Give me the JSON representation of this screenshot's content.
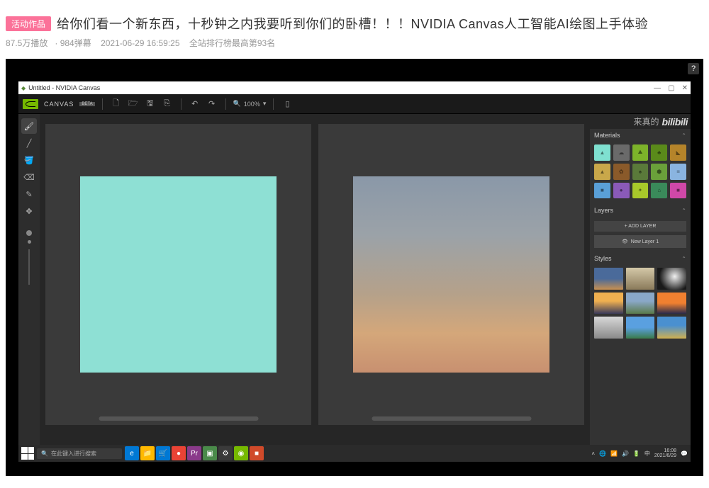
{
  "page": {
    "activity_tag": "活动作品",
    "video_title": "给你们看一个新东西，十秒钟之内我要听到你们的卧槽！！！NVIDIA Canvas人工智能AI绘图上手体验",
    "play_count": "87.5万播放",
    "danmu_count": "984弹幕",
    "publish_time": "2021-06-29 16:59:25",
    "rank_text": "全站排行榜最高第93名",
    "help_icon": "?"
  },
  "window": {
    "title": "Untitled - NVIDIA Canvas",
    "min": "—",
    "max": "▢",
    "close": "✕"
  },
  "app": {
    "brand": "CANVAS",
    "beta": "BETA",
    "zoom_label": "100%"
  },
  "watermark": {
    "text": "来真的",
    "logo": "bilibili"
  },
  "panels": {
    "materials_title": "Materials",
    "layers_title": "Layers",
    "add_layer": "+ ADD LAYER",
    "layer_name": "New Layer 1",
    "styles_title": "Styles"
  },
  "materials": [
    {
      "bg": "#7fe0d0",
      "icon": "▲"
    },
    {
      "bg": "#6a6a6a",
      "icon": "☁"
    },
    {
      "bg": "#7db32a",
      "icon": "⛰"
    },
    {
      "bg": "#5a8a1a",
      "icon": "♣"
    },
    {
      "bg": "#b5842a",
      "icon": "◣"
    },
    {
      "bg": "#c9a84a",
      "icon": "▲"
    },
    {
      "bg": "#8a5a2a",
      "icon": "✿"
    },
    {
      "bg": "#5a7a3a",
      "icon": "♠"
    },
    {
      "bg": "#6aa03a",
      "icon": "⬢"
    },
    {
      "bg": "#8ab4e0",
      "icon": "≡"
    },
    {
      "bg": "#5aa0d8",
      "icon": "■"
    },
    {
      "bg": "#8a5ab8",
      "icon": "●"
    },
    {
      "bg": "#a8c82a",
      "icon": "✦"
    },
    {
      "bg": "#3a8a5a",
      "icon": "⌂"
    },
    {
      "bg": "#d048a8",
      "icon": "■"
    }
  ],
  "styles": [
    {
      "bg": "linear-gradient(to bottom,#4a6a9a 50%,#c89050 100%)"
    },
    {
      "bg": "linear-gradient(to bottom,#d4c8a8,#8a7a5a)"
    },
    {
      "bg": "radial-gradient(circle at 60% 40%,#f0f0f0,#1a1a1a 70%)"
    },
    {
      "bg": "linear-gradient(to bottom,#f0b050 40%,#3a3a5a 100%)"
    },
    {
      "bg": "linear-gradient(to bottom,#8aa8c8 40%,#5a7a4a 100%)"
    },
    {
      "bg": "linear-gradient(to bottom,#f08030 50%,#2a2a4a 100%)"
    },
    {
      "bg": "linear-gradient(to bottom,#d8d8d8,#8a8a8a)"
    },
    {
      "bg": "linear-gradient(to bottom,#5aa0e0 50%,#3a7a4a 100%)"
    },
    {
      "bg": "linear-gradient(to bottom,#4a90d0 40%,#d0b050 100%)"
    }
  ],
  "taskbar": {
    "search_placeholder": "在此键入进行搜索",
    "apps": [
      {
        "bg": "#0078d4",
        "t": "e"
      },
      {
        "bg": "#ffb900",
        "t": "📁"
      },
      {
        "bg": "#0078d4",
        "t": "🛒"
      },
      {
        "bg": "#ea4335",
        "t": "●"
      },
      {
        "bg": "#8a3a8a",
        "t": "Pr"
      },
      {
        "bg": "#4a8a4a",
        "t": "▣"
      },
      {
        "bg": "#3a3a3a",
        "t": "⚙"
      },
      {
        "bg": "#76b900",
        "t": "◉"
      },
      {
        "bg": "#d04a2a",
        "t": "■"
      }
    ],
    "time": "16:08",
    "date": "2021/6/29"
  }
}
